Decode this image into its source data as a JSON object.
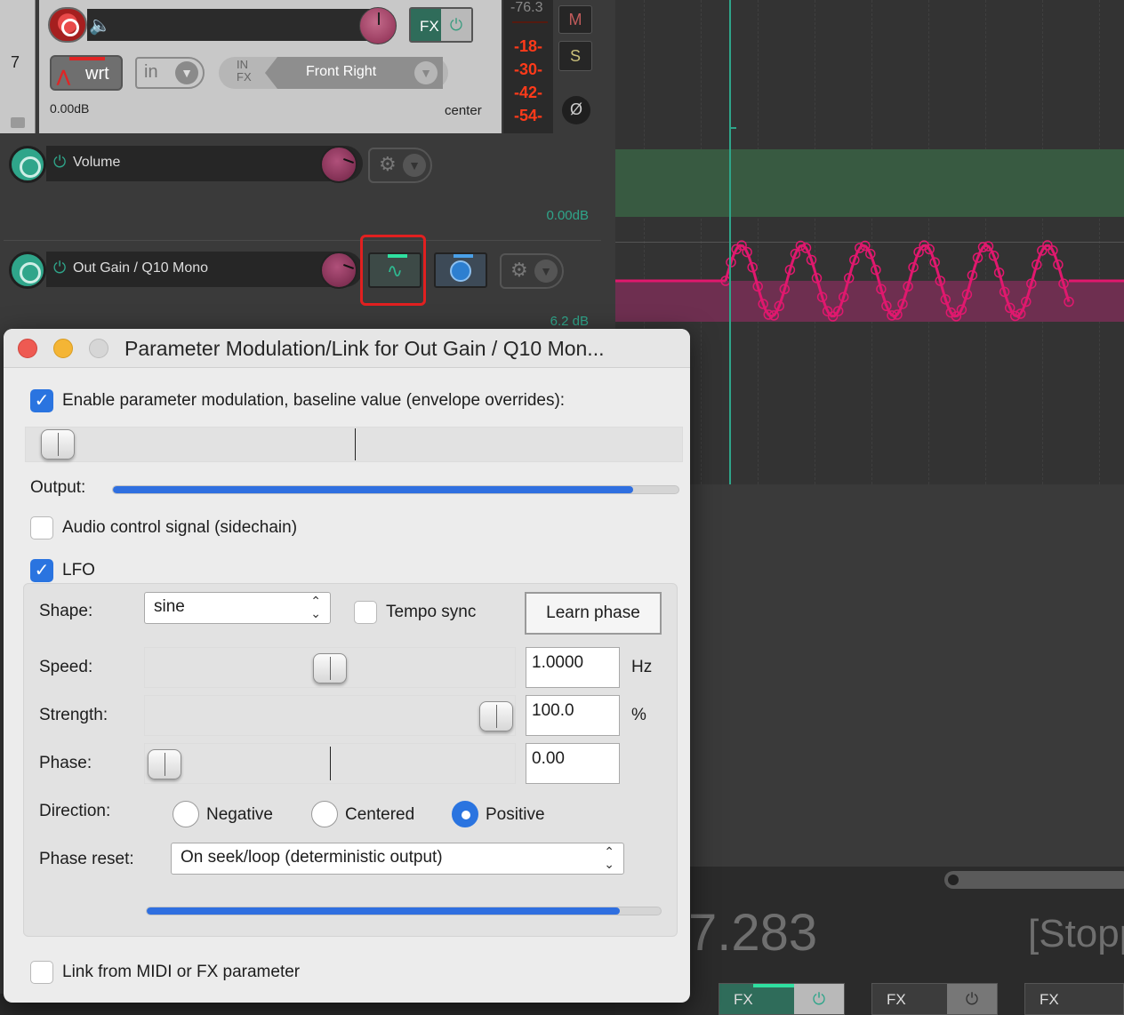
{
  "track": {
    "number": "7",
    "automation_mode": "wrt",
    "input_label": "in",
    "input_route_label_1": "IN",
    "input_route_label_2": "FX",
    "input_channel": "Front Right",
    "volume": "0.00dB",
    "pan": "center",
    "fx_label": "FX",
    "meter_peak": "-76.3",
    "meter_marks": [
      "-18-",
      "-30-",
      "-42-",
      "-54-"
    ],
    "mute_label": "M",
    "solo_label": "S",
    "phase_label": "Ø"
  },
  "envelopes": [
    {
      "name": "Volume",
      "value": "0.00dB"
    },
    {
      "name": "Out Gain / Q10 Mono",
      "value": "6.2 dB"
    }
  ],
  "dialog": {
    "title": "Parameter Modulation/Link for Out Gain / Q10 Mon...",
    "enable_label": "Enable parameter modulation, baseline value (envelope overrides):",
    "enable_checked": true,
    "baseline_level": 0.02,
    "output_label": "Output:",
    "output_level": 0.92,
    "audio_control_label": "Audio control signal (sidechain)",
    "audio_control_checked": false,
    "lfo_label": "LFO",
    "lfo_checked": true,
    "shape_label": "Shape:",
    "shape_value": "sine",
    "tempo_sync_label": "Tempo sync",
    "tempo_sync_checked": false,
    "learn_phase_label": "Learn phase",
    "speed_label": "Speed:",
    "speed_value": "1.0000",
    "speed_unit": "Hz",
    "strength_label": "Strength:",
    "strength_value": "100.0",
    "strength_unit": "%",
    "phase_label": "Phase:",
    "phase_value": "0.00",
    "direction_label": "Direction:",
    "direction_options": [
      "Negative",
      "Centered",
      "Positive"
    ],
    "direction_selected": "Positive",
    "phase_reset_label": "Phase reset:",
    "phase_reset_value": "On seek/loop (deterministic output)",
    "lfo_output_level": 0.92,
    "link_label": "Link from MIDI or FX parameter",
    "link_checked": false
  },
  "transport": {
    "time": "7.283",
    "status": "[Stopp"
  },
  "mixer_fx_slots": [
    "FX",
    "FX",
    "FX"
  ],
  "colors": {
    "accent": "#2fa58a",
    "lfo_envelope": "#e0186e",
    "checkbox_blue": "#2a74e0",
    "record_red": "#e02525"
  }
}
